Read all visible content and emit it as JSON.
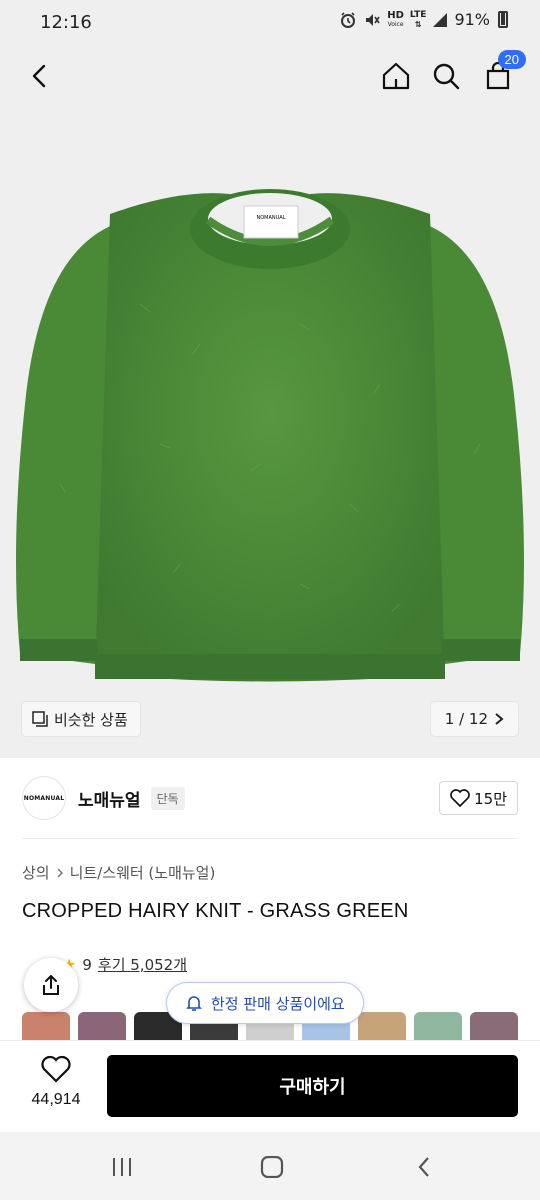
{
  "status_bar": {
    "time": "12:16",
    "network_top": "HD",
    "network_bottom": "Voice",
    "lte": "LTE",
    "battery": "91%"
  },
  "header": {
    "back_icon": "chevron-left-icon",
    "home_icon": "home-icon",
    "search_icon": "search-icon",
    "cart_icon": "shopping-bag-icon",
    "cart_badge": "20"
  },
  "gallery": {
    "similar_label": "비슷한 상품",
    "pager": "1 / 12",
    "brand_patch": "NOMANUAL"
  },
  "brand": {
    "logo_text": "NOMANUAL",
    "name": "노매뉴얼",
    "tag": "단독",
    "likes": "15만"
  },
  "product": {
    "breadcrumb": [
      "상의",
      "니트/스웨터 (노매뉴얼)"
    ],
    "title": "CROPPED HAIRY KNIT - GRASS GREEN",
    "rating_text": "9",
    "reviews_label": "후기 5,052개",
    "limited_label": "한정 판매 상품이에요"
  },
  "swatches": {
    "colors": [
      "#c9826c",
      "#8a6678",
      "#2a2a2a",
      "#3b3b3b",
      "#cfcfcf",
      "#a7c3e6",
      "#c7a37a",
      "#8fb7a0",
      "#8a6b78"
    ]
  },
  "action_bar": {
    "wish_count": "44,914",
    "buy_label": "구매하기"
  },
  "colors": {
    "accent_blue": "#2f6ff5",
    "sweater_green": "#4c8c3a",
    "buy_black": "#000000"
  }
}
